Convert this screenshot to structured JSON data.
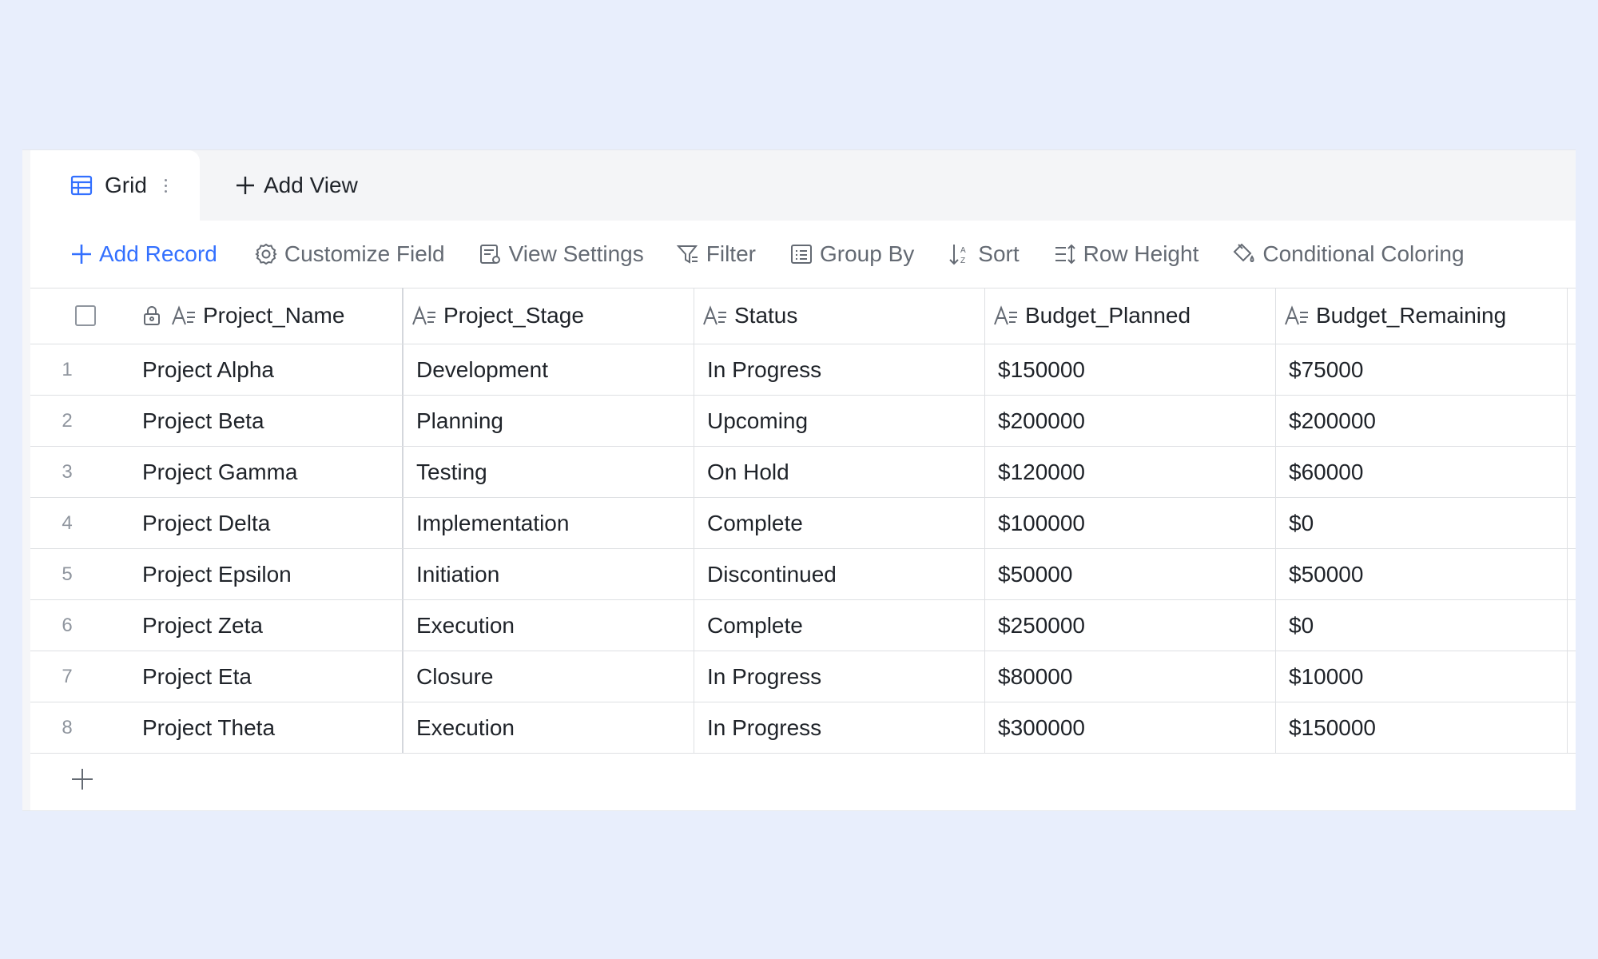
{
  "tabs": {
    "active_label": "Grid",
    "add_view_label": "Add View"
  },
  "toolbar": {
    "add_record": "Add Record",
    "customize_field": "Customize Field",
    "view_settings": "View Settings",
    "filter": "Filter",
    "group_by": "Group By",
    "sort": "Sort",
    "row_height": "Row Height",
    "conditional_coloring": "Conditional Coloring"
  },
  "columns": [
    "Project_Name",
    "Project_Stage",
    "Status",
    "Budget_Planned",
    "Budget_Remaining"
  ],
  "rows": [
    {
      "index": "1",
      "cells": [
        "Project Alpha",
        "Development",
        "In Progress",
        "$150000",
        "$75000"
      ]
    },
    {
      "index": "2",
      "cells": [
        "Project Beta",
        "Planning",
        "Upcoming",
        "$200000",
        "$200000"
      ]
    },
    {
      "index": "3",
      "cells": [
        "Project Gamma",
        "Testing",
        "On Hold",
        "$120000",
        "$60000"
      ]
    },
    {
      "index": "4",
      "cells": [
        "Project Delta",
        "Implementation",
        "Complete",
        "$100000",
        "$0"
      ]
    },
    {
      "index": "5",
      "cells": [
        "Project Epsilon",
        "Initiation",
        "Discontinued",
        "$50000",
        "$50000"
      ]
    },
    {
      "index": "6",
      "cells": [
        "Project Zeta",
        "Execution",
        "Complete",
        "$250000",
        "$0"
      ]
    },
    {
      "index": "7",
      "cells": [
        "Project Eta",
        "Closure",
        "In Progress",
        "$80000",
        "$10000"
      ]
    },
    {
      "index": "8",
      "cells": [
        "Project Theta",
        "Execution",
        "In Progress",
        "$300000",
        "$150000"
      ]
    }
  ],
  "icons": {
    "grid_tab": "grid-icon",
    "tab_more": "more-vertical-icon",
    "add_view": "plus-icon",
    "add_record": "plus-icon",
    "customize_field": "gear-icon",
    "view_settings": "view-settings-icon",
    "filter": "filter-icon",
    "group_by": "group-icon",
    "sort": "sort-icon",
    "row_height": "row-height-icon",
    "conditional_coloring": "paint-bucket-icon",
    "primary_field": "lock-icon",
    "text_field": "text-field-icon",
    "add_row": "plus-icon"
  },
  "colors": {
    "accent": "#3370ff",
    "page_background": "#e8eefc",
    "toolbar_text": "#646a73",
    "grid_lines": "#dee0e3"
  }
}
